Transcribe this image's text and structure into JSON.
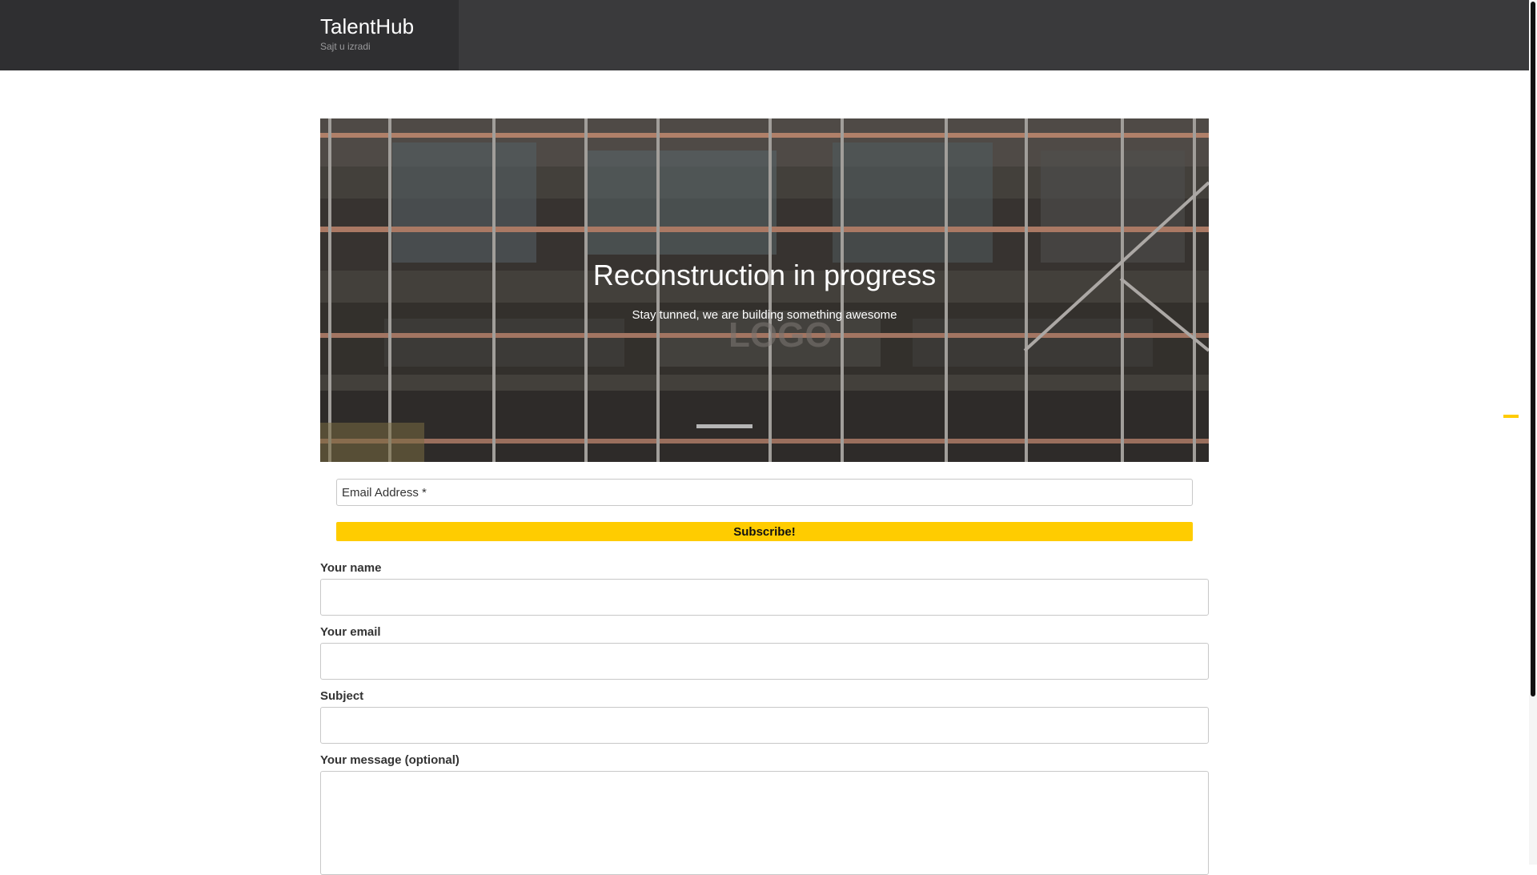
{
  "header": {
    "site_title": "TalentHub",
    "tagline": "Sajt u izradi"
  },
  "hero": {
    "title": "Reconstruction in progress",
    "subtitle": "Stay tunned, we are building something awesome"
  },
  "subscribe": {
    "email_placeholder": "Email Address *",
    "button_label": "Subscribe!"
  },
  "contact_form": {
    "name_label": "Your name",
    "email_label": "Your email",
    "subject_label": "Subject",
    "message_label": "Your message (optional)"
  },
  "colors": {
    "header_bg": "#3a3a3c",
    "accent": "#ffcc00"
  }
}
